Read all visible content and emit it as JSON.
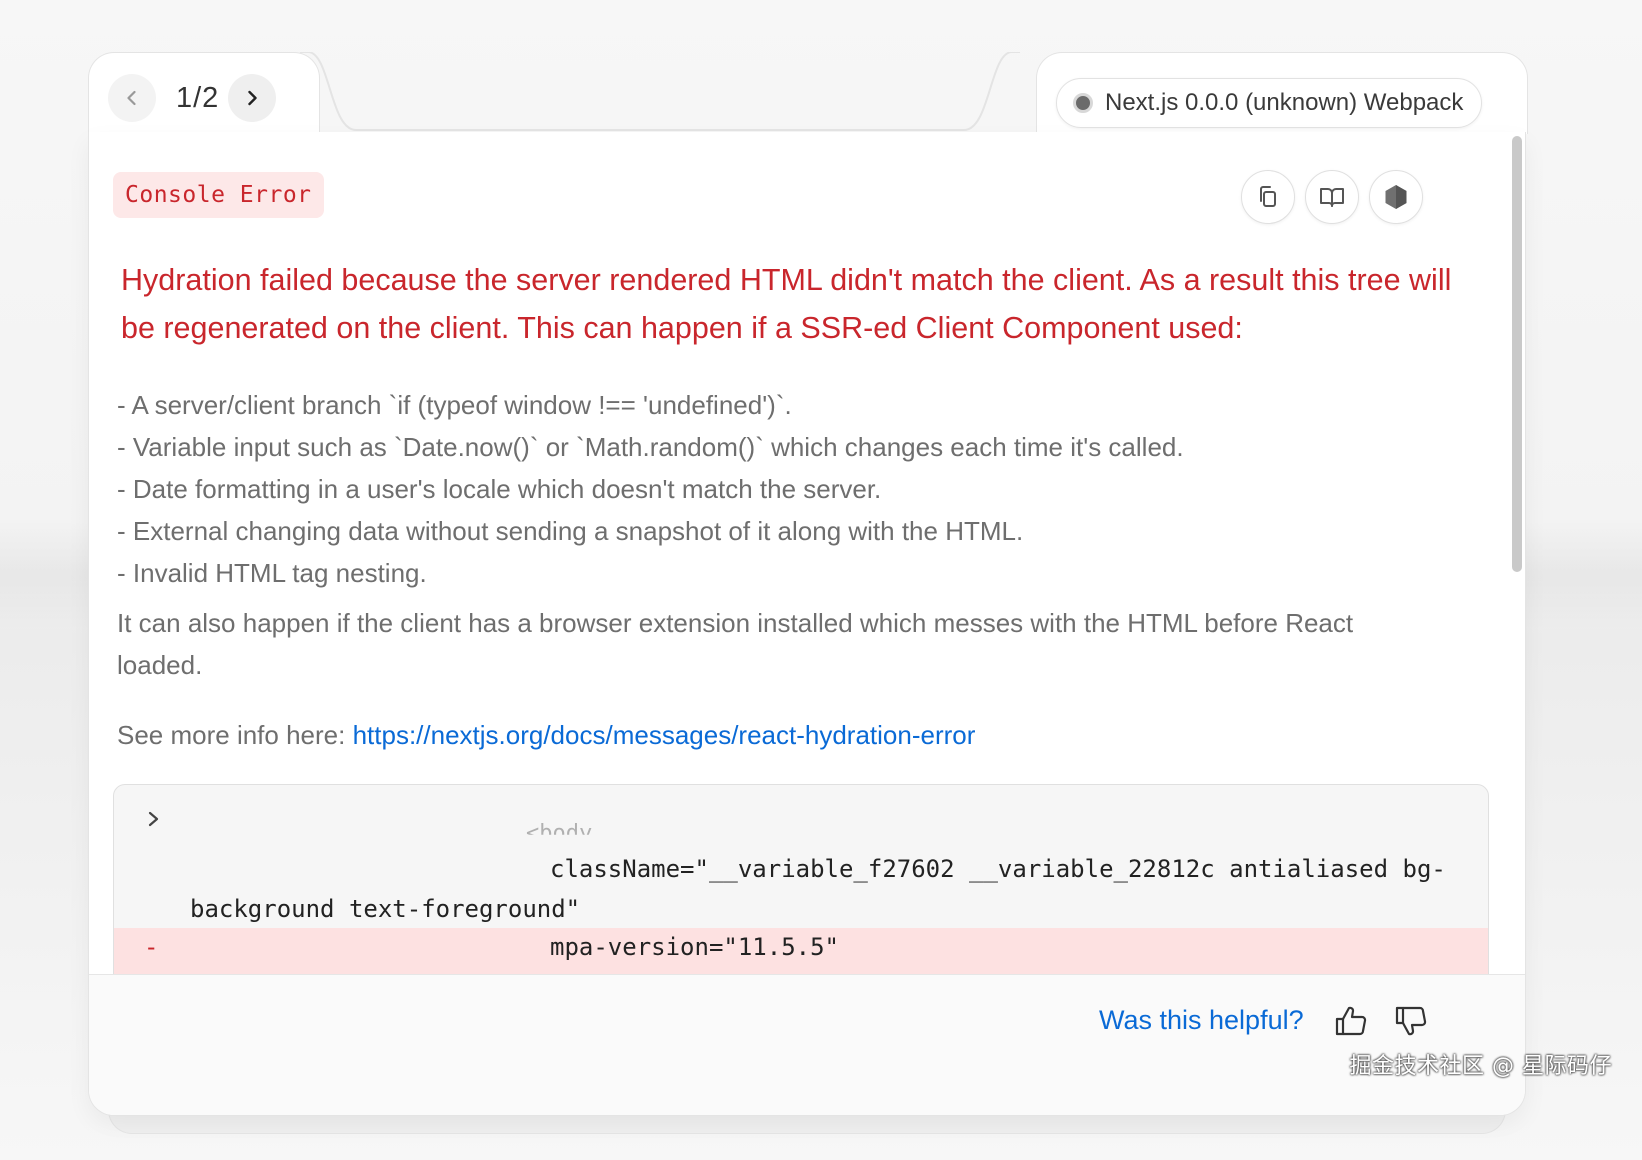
{
  "pager": {
    "text": "1/2",
    "prev_icon": "chevron-left-icon",
    "next_icon": "chevron-right-icon"
  },
  "version": {
    "label": "Next.js 0.0.0 (unknown) Webpack",
    "indicator_color": "#6b6b6b"
  },
  "error": {
    "badge": "Console Error",
    "headline": "Hydration failed because the server rendered HTML didn't match the client. As a result this tree will be regenerated on the client. This can happen if a SSR-ed Client Component used:",
    "causes": [
      "- A server/client branch `if (typeof window !== 'undefined')`.",
      "- Variable input such as `Date.now()` or `Math.random()` which changes each time it's called.",
      "- Date formatting in a user's locale which doesn't match the server.",
      "- External changing data without sending a snapshot of it along with the HTML.",
      "- Invalid HTML tag nesting."
    ],
    "extra": "It can also happen if the client has a browser extension installed which messes with the HTML before React loaded.",
    "more_info_prefix": "See more info here: ",
    "more_info_link": "https://nextjs.org/docs/messages/react-hydration-error"
  },
  "toolbar": {
    "copy_icon": "copy-icon",
    "docs_icon": "book-icon",
    "nodejs_icon": "nodejs-hexagon-icon"
  },
  "code": {
    "ghost": "<body",
    "line1": "className=\"__variable_f27602 __variable_22812c antialiased bg-",
    "line2": "background text-foreground\"",
    "removed_marker": "-",
    "line3": "mpa-version=\"11.5.5\""
  },
  "footer": {
    "helpful": "Was this helpful?",
    "thumbs_up_icon": "thumbs-up-icon",
    "thumbs_down_icon": "thumbs-down-icon"
  },
  "watermark": "掘金技术社区 @ 星际码仔",
  "colors": {
    "error_red": "#c9262c",
    "link_blue": "#0a6ad6",
    "badge_bg": "#fde8e8",
    "removed_bg": "#fde1e1"
  }
}
